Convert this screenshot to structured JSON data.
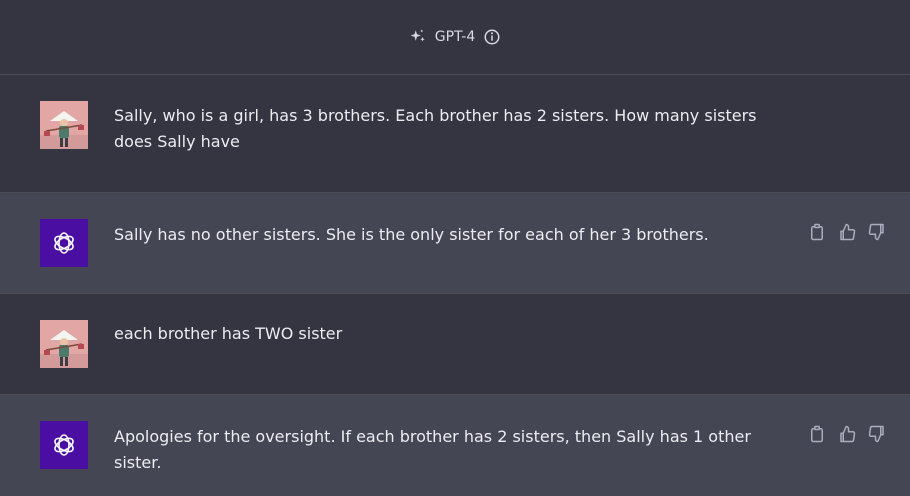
{
  "header": {
    "model_label": "GPT-4",
    "icons": [
      "sparkle-icon",
      "info-icon"
    ]
  },
  "messages": [
    {
      "role": "user",
      "text": "Sally, who is a girl, has 3 brothers. Each brother has 2 sisters. How many sisters does Sally have"
    },
    {
      "role": "assistant",
      "text": "Sally has no other sisters. She is the only sister for each of her 3 brothers."
    },
    {
      "role": "user",
      "text": "each brother has TWO sister"
    },
    {
      "role": "assistant",
      "text": "Apologies for the oversight. If each brother has 2 sisters, then Sally has 1 other sister."
    }
  ],
  "actions": [
    "copy-icon",
    "thumbs-up-icon",
    "thumbs-down-icon"
  ],
  "colors": {
    "background": "#343541",
    "assistant_row": "#444654",
    "assistant_avatar": "#4a0ea3",
    "text": "#ececf1"
  }
}
